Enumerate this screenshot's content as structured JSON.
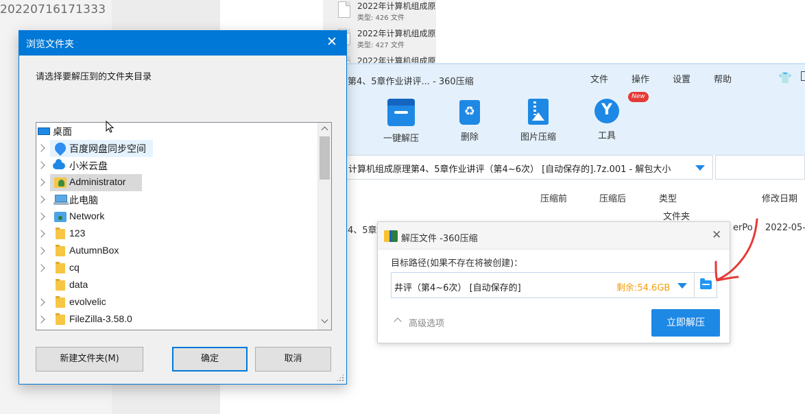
{
  "background": {
    "explorer_filename": "20220716171333",
    "files": [
      {
        "name": "2022年计算机组成原",
        "meta": "类型: 426 文件"
      },
      {
        "name": "2022年计算机组成原",
        "meta": "类型: 427 文件"
      },
      {
        "name": "2022年计算机组成原",
        "meta": ""
      }
    ]
  },
  "app": {
    "window_title": "第4、5章作业讲评... - 360压缩",
    "menu": [
      "文件",
      "操作",
      "设置",
      "帮助"
    ],
    "toolbar": [
      {
        "label": "一键解压",
        "icon": "extract-icon"
      },
      {
        "label": "删除",
        "icon": "recycle-icon"
      },
      {
        "label": "图片压缩",
        "icon": "image-compress-icon"
      },
      {
        "label": "工具",
        "icon": "tools-icon"
      }
    ],
    "new_badge": "New",
    "path_text": "计算机组成原理第4、5章作业讲评（第4~6次） [自动保存的].7z.001 - 解包大小",
    "columns": [
      "压缩前",
      "压缩后",
      "类型",
      "修改日期"
    ],
    "row_name": "4、5章",
    "row_type": "文件夹",
    "row_extra": "erPo",
    "row_date": "2022-05-"
  },
  "extract_dialog": {
    "title": "解压文件 -360压缩",
    "target_label": "目标路径(如果不存在将被创建)：",
    "path_value": "井评（第4~6次） [自动保存的]",
    "free_space": "剩余:54.6GB",
    "advanced_label": "高级选项",
    "extract_button": "立即解压",
    "accent_color": "#1e88e5"
  },
  "browse_dialog": {
    "title": "浏览文件夹",
    "prompt": "请选择要解压到的文件夹目录",
    "tree": [
      {
        "label": "桌面",
        "icon": "desktop-icon",
        "expandable": false,
        "indent": 0
      },
      {
        "label": "百度网盘同步空间",
        "icon": "baidu-netdisk-icon",
        "expandable": true,
        "indent": 1,
        "state": "hover"
      },
      {
        "label": "小米云盘",
        "icon": "cloud-icon",
        "expandable": true,
        "indent": 1
      },
      {
        "label": "Administrator",
        "icon": "user-folder-icon",
        "expandable": true,
        "indent": 1,
        "state": "selected"
      },
      {
        "label": "此电脑",
        "icon": "this-pc-icon",
        "expandable": true,
        "indent": 1
      },
      {
        "label": "Network",
        "icon": "network-icon",
        "expandable": true,
        "indent": 1
      },
      {
        "label": "123",
        "icon": "folder-icon",
        "expandable": true,
        "indent": 1
      },
      {
        "label": "AutumnBox",
        "icon": "folder-icon",
        "expandable": true,
        "indent": 1
      },
      {
        "label": "cq",
        "icon": "folder-icon",
        "expandable": true,
        "indent": 1
      },
      {
        "label": "data",
        "icon": "folder-icon",
        "expandable": false,
        "indent": 1
      },
      {
        "label": "evolvelic",
        "icon": "folder-icon",
        "expandable": true,
        "indent": 1
      },
      {
        "label": "FileZilla-3.58.0",
        "icon": "folder-icon",
        "expandable": true,
        "indent": 1
      }
    ],
    "new_folder_button": "新建文件夹(M)",
    "ok_button": "确定",
    "cancel_button": "取消",
    "title_color": "#0078d7"
  }
}
